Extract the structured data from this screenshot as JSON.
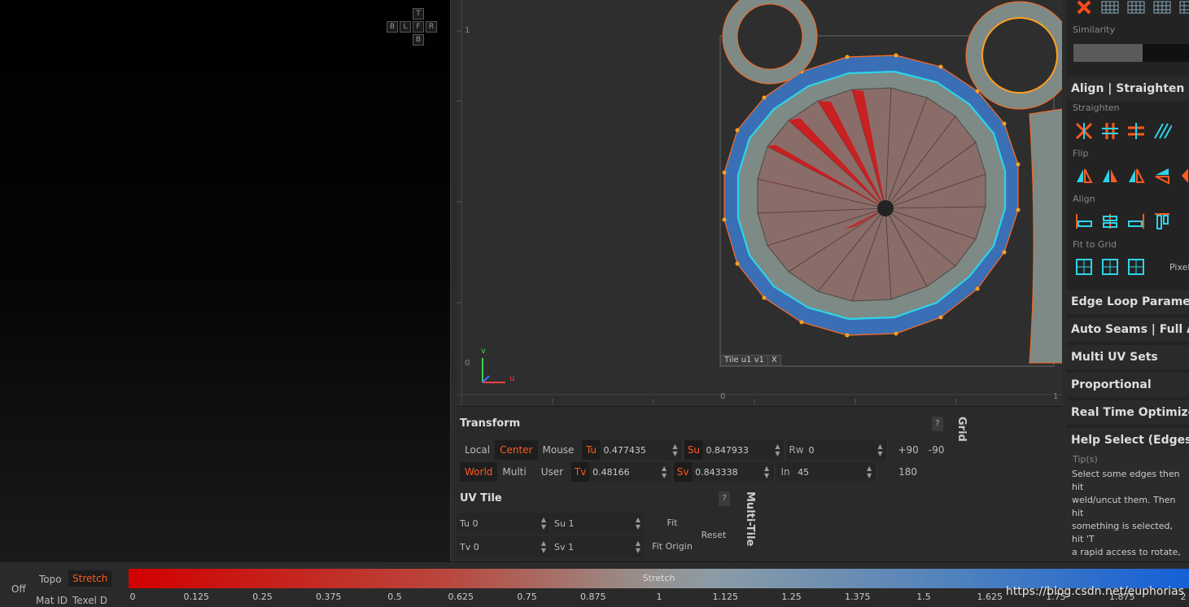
{
  "nav_cube": {
    "top": "T",
    "bottom": "B",
    "left": "L",
    "front": "F",
    "right": "R",
    "back": "B"
  },
  "uv_editor": {
    "axis_v_top": "1",
    "axis_v_zero": "0",
    "axis_u_zero": "0",
    "axis_u_one": "1",
    "gizmo_v": "v",
    "gizmo_u": "u",
    "tile_label": "Tile u1  v1",
    "tile_close": "X"
  },
  "transform": {
    "title": "Transform",
    "help": "?",
    "local": "Local",
    "center": "Center",
    "mouse": "Mouse",
    "world": "World",
    "multi": "Multi",
    "user": "User",
    "tu_label": "Tu",
    "tu_value": "0.477435",
    "tv_label": "Tv",
    "tv_value": "0.48166",
    "su_label": "Su",
    "su_value": "0.847933",
    "sv_label": "Sv",
    "sv_value": "0.843338",
    "rw_label": "Rw",
    "rw_value": "0",
    "in_label": "In",
    "in_value": "45",
    "plus90": "+90",
    "minus90": "-90",
    "r180": "180"
  },
  "grid_tab": "Grid",
  "uv_tile": {
    "title": "UV Tile",
    "help": "?",
    "tu": "Tu 0",
    "tv": "Tv 0",
    "su": "Su 1",
    "sv": "Sv 1",
    "fit": "Fit",
    "fit_origin": "Fit Origin",
    "reset": "Reset"
  },
  "multi_tile_tab": "Multi-Tile",
  "right_panel": {
    "similarity_label": "Similarity",
    "similarity_value": 0.6,
    "align_header": "Align | Straighten | Flip",
    "straighten_label": "Straighten",
    "flip_label": "Flip",
    "align_label": "Align",
    "fit_to_grid_label": "Fit to Grid",
    "pixel_label": "Pixel",
    "sections": [
      "Edge Loop Parameters",
      "Auto Seams | Full AUTO",
      "Multi UV Sets",
      "Proportional",
      "Real Time Optimize",
      "Help Select (Edges)"
    ],
    "tips_label": "Tip(s)",
    "tips_text": "Select some edges then hit\nweld/uncut them. Then hit\nsomething is selected, hit 'T\na rapid access to rotate, tran\nmouse buttons to drag the\npointer."
  },
  "bottom_bar": {
    "off": "Off",
    "topo": "Topo",
    "stretch": "Stretch",
    "mat_id": "Mat ID",
    "texel": "Texel D",
    "gradient_label": "Stretch",
    "scale": [
      "0",
      "0.125",
      "0.25",
      "0.375",
      "0.5",
      "0.625",
      "0.75",
      "0.875",
      "1",
      "1.125",
      "1.25",
      "1.375",
      "1.5",
      "1.625",
      "1.75",
      "1.875",
      "2"
    ],
    "watermark": "https://blog.csdn.net/euphorias"
  },
  "colors": {
    "accent": "#ff5a1f",
    "uv_selected": "#2dd4e8",
    "stretch_low": "#d20000",
    "stretch_high": "#1560d8"
  }
}
